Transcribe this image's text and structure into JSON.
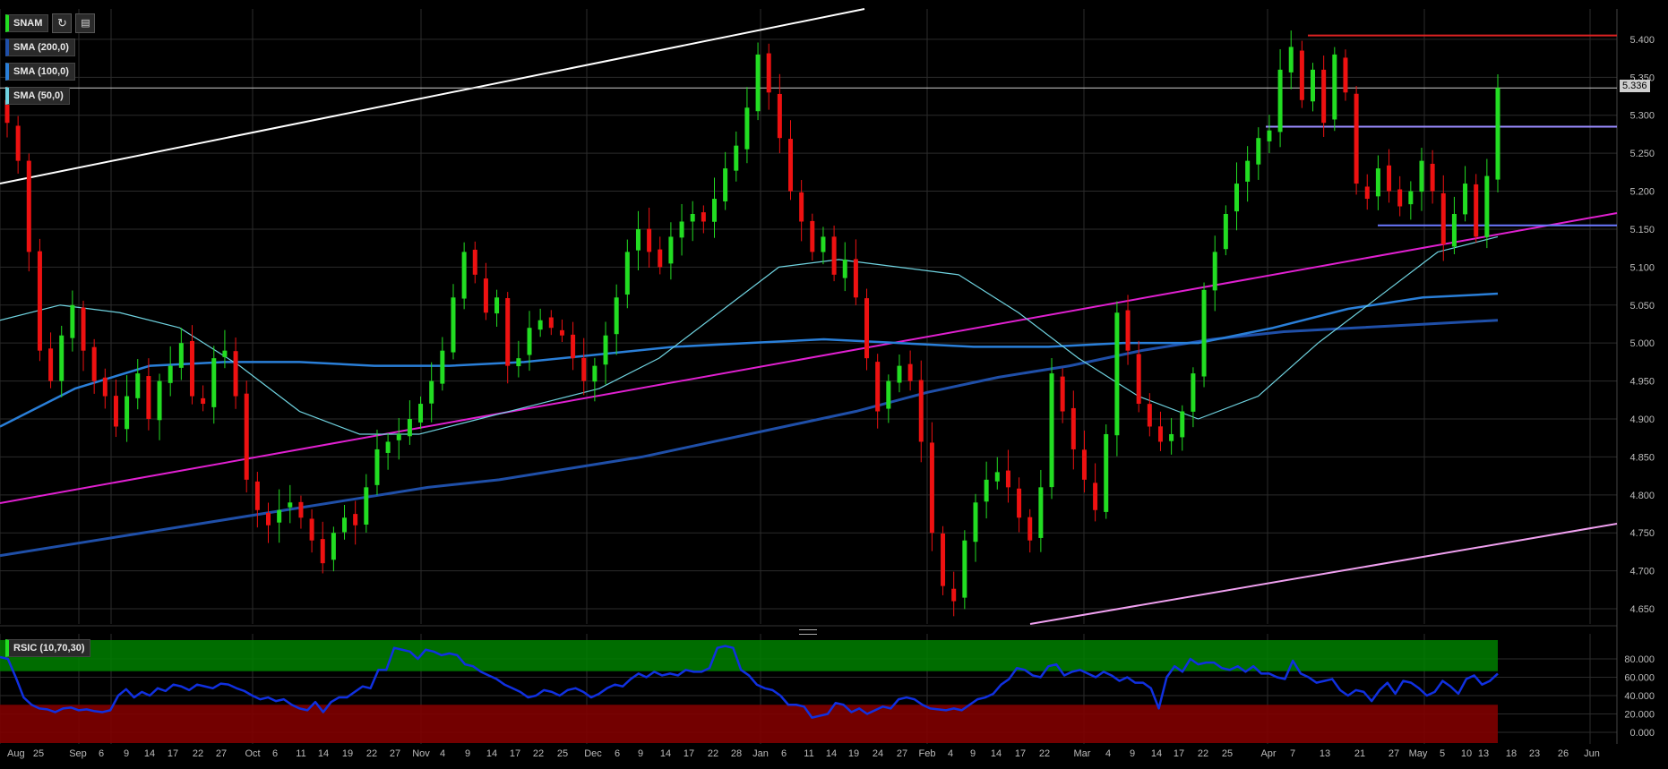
{
  "symbol": "SNAM",
  "toolbar": {
    "refresh_icon": "refresh-icon",
    "settings_icon": "chart-settings-icon"
  },
  "indicators": [
    {
      "label": "SMA (200,0)",
      "color": "#1f4fa8"
    },
    {
      "label": "SMA (100,0)",
      "color": "#2a7fd8"
    },
    {
      "label": "SMA (50,0)",
      "color": "#6fd3e0"
    }
  ],
  "rsi_label": "RSIC (10,70,30)",
  "last_price_label": "5.336",
  "colors": {
    "up": "#22dd22",
    "down": "#ee1111",
    "grid": "#2b2b2b",
    "rsi_line": "#1030e0",
    "zone_high": "#008000",
    "zone_low": "#800000",
    "trend_magenta": "#e020d0",
    "channel_pink": "#f0a0f0",
    "channel_white": "#ffffff",
    "resistance_red": "#dd2222",
    "level_purple": "#9a8cff",
    "level_blue": "#6a78ff"
  },
  "chart_data": [
    {
      "type": "candlestick",
      "title": "SNAM",
      "y_ticks": [
        "4.650",
        "4.700",
        "4.750",
        "4.800",
        "4.850",
        "4.900",
        "4.950",
        "5.000",
        "5.050",
        "5.100",
        "5.150",
        "5.200",
        "5.250",
        "5.300",
        "5.350",
        "5.400"
      ],
      "ylim": [
        4.63,
        5.44
      ],
      "x_ticks": [
        "Aug",
        "25",
        "Sep",
        "6",
        "9",
        "14",
        "17",
        "22",
        "27",
        "Oct",
        "6",
        "11",
        "14",
        "19",
        "22",
        "27",
        "Nov",
        "4",
        "9",
        "14",
        "17",
        "22",
        "25",
        "Dec",
        "6",
        "9",
        "14",
        "17",
        "22",
        "28",
        "Jan",
        "6",
        "11",
        "14",
        "19",
        "24",
        "27",
        "Feb",
        "4",
        "9",
        "14",
        "17",
        "22",
        "Mar",
        "4",
        "9",
        "14",
        "17",
        "22",
        "25",
        "Apr",
        "7",
        "13",
        "21",
        "27",
        "May",
        "5",
        "10",
        "13",
        "18",
        "23",
        "26",
        "Jun"
      ],
      "last_price": 5.336,
      "grid": true,
      "close": [
        5.29,
        5.24,
        5.12,
        4.99,
        4.95,
        5.01,
        5.05,
        4.99,
        4.95,
        4.93,
        4.89,
        4.93,
        4.96,
        4.9,
        4.95,
        4.97,
        5.0,
        4.93,
        4.92,
        4.98,
        4.99,
        4.93,
        4.82,
        4.78,
        4.76,
        4.78,
        4.79,
        4.77,
        4.74,
        4.71,
        4.75,
        4.77,
        4.76,
        4.81,
        4.86,
        4.87,
        4.88,
        4.9,
        4.92,
        4.95,
        4.99,
        5.06,
        5.12,
        5.09,
        5.04,
        5.06,
        4.97,
        4.98,
        5.02,
        5.03,
        5.02,
        5.01,
        4.98,
        4.95,
        4.97,
        5.01,
        5.06,
        5.12,
        5.15,
        5.12,
        5.1,
        5.14,
        5.16,
        5.17,
        5.16,
        5.19,
        5.23,
        5.26,
        5.31,
        5.38,
        5.33,
        5.27,
        5.2,
        5.16,
        5.12,
        5.14,
        5.09,
        5.11,
        5.06,
        4.98,
        4.91,
        4.95,
        4.97,
        4.95,
        4.87,
        4.75,
        4.68,
        4.66,
        4.74,
        4.79,
        4.82,
        4.83,
        4.81,
        4.77,
        4.74,
        4.81,
        4.96,
        4.91,
        4.86,
        4.82,
        4.78,
        4.88,
        5.04,
        4.99,
        4.92,
        4.89,
        4.87,
        4.88,
        4.91,
        4.96,
        5.07,
        5.12,
        5.17,
        5.21,
        5.24,
        5.27,
        5.28,
        5.36,
        5.39,
        5.32,
        5.36,
        5.29,
        5.38,
        5.33,
        5.21,
        5.19,
        5.23,
        5.2,
        5.18,
        5.2,
        5.24,
        5.2,
        5.13,
        5.17,
        5.21,
        5.14,
        5.22,
        5.336
      ],
      "series": [
        {
          "name": "SMA (200,0)",
          "values": [
            4.72,
            4.735,
            4.75,
            4.765,
            4.78,
            4.795,
            4.81,
            4.82,
            4.835,
            4.85,
            4.87,
            4.89,
            4.91,
            4.935,
            4.955,
            4.97,
            4.99,
            5.005,
            5.015,
            5.02,
            5.025,
            5.03
          ]
        },
        {
          "name": "SMA (100,0)",
          "values": [
            4.89,
            4.94,
            4.97,
            4.975,
            4.975,
            4.97,
            4.97,
            4.975,
            4.985,
            4.995,
            5.0,
            5.005,
            5.0,
            4.995,
            4.995,
            5.0,
            5.0,
            5.02,
            5.045,
            5.06,
            5.065
          ]
        },
        {
          "name": "SMA (50,0)",
          "values": [
            5.03,
            5.05,
            5.04,
            5.02,
            4.97,
            4.91,
            4.88,
            4.88,
            4.9,
            4.92,
            4.94,
            4.98,
            5.04,
            5.1,
            5.11,
            5.1,
            5.09,
            5.04,
            4.98,
            4.93,
            4.9,
            4.93,
            5.0,
            5.06,
            5.12,
            5.14
          ]
        }
      ],
      "levels": [
        {
          "name": "resistance",
          "value": 5.405
        },
        {
          "name": "upper range",
          "value": 5.285
        },
        {
          "name": "lower range",
          "value": 5.155
        },
        {
          "name": "last price",
          "value": 5.336
        }
      ]
    },
    {
      "type": "line",
      "title": "RSIC (10,70,30)",
      "y_ticks": [
        "0.000",
        "20.000",
        "40.000",
        "60.000",
        "80.000"
      ],
      "ylim": [
        0,
        100
      ],
      "zones": {
        "overbought": 70,
        "oversold": 30
      },
      "values": [
        82,
        80,
        60,
        38,
        30,
        26,
        25,
        22,
        26,
        27,
        24,
        25,
        23,
        22,
        24,
        40,
        47,
        38,
        44,
        40,
        48,
        45,
        52,
        50,
        46,
        52,
        50,
        48,
        53,
        52,
        48,
        45,
        40,
        36,
        38,
        34,
        36,
        30,
        26,
        24,
        33,
        22,
        33,
        38,
        38,
        44,
        50,
        48,
        68,
        68,
        92,
        90,
        88,
        80,
        90,
        88,
        84,
        86,
        84,
        74,
        72,
        66,
        62,
        58,
        52,
        48,
        44,
        38,
        40,
        46,
        44,
        40,
        46,
        48,
        44,
        38,
        42,
        48,
        52,
        50,
        58,
        64,
        60,
        66,
        62,
        64,
        62,
        68,
        66,
        66,
        70,
        92,
        94,
        92,
        68,
        62,
        52,
        48,
        46,
        40,
        30,
        30,
        28,
        16,
        18,
        20,
        32,
        30,
        22,
        26,
        20,
        24,
        28,
        26,
        36,
        38,
        36,
        30,
        26,
        25,
        24,
        26,
        24,
        30,
        36,
        38,
        42,
        52,
        58,
        70,
        68,
        62,
        60,
        72,
        74,
        62,
        66,
        68,
        64,
        60,
        66,
        62,
        56,
        60,
        54,
        54,
        48,
        26,
        60,
        72,
        66,
        80,
        74,
        76,
        76,
        70,
        68,
        72,
        66,
        72,
        64,
        64,
        60,
        58,
        78,
        64,
        60,
        54,
        56,
        58,
        46,
        40,
        46,
        44,
        34,
        46,
        54,
        42,
        56,
        54,
        48,
        40,
        44,
        56,
        50,
        42,
        58,
        62,
        52,
        56,
        64
      ]
    }
  ]
}
